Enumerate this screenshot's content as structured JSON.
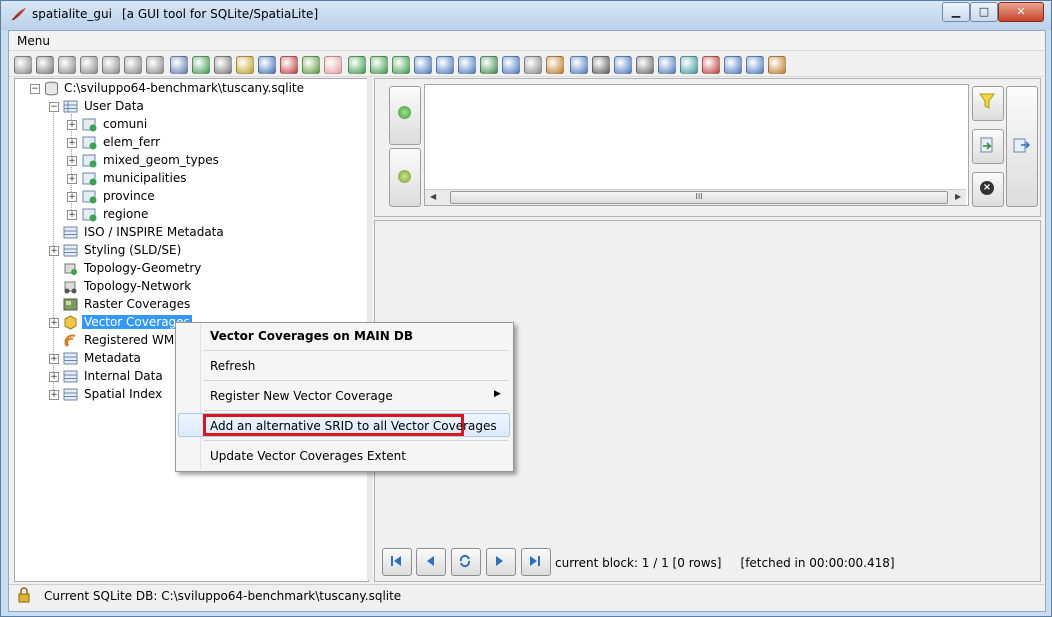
{
  "window": {
    "app_name": "spatialite_gui",
    "subtitle": "[a GUI tool for SQLite/SpatiaLite]",
    "controls": {
      "minimize": "▁",
      "maximize": "□",
      "close": "✕"
    }
  },
  "menubar": {
    "menu_label": "Menu"
  },
  "tree": {
    "root": "C:\\sviluppo64-benchmark\\tuscany.sqlite",
    "user_data": "User Data",
    "tables": [
      "comuni",
      "elem_ferr",
      "mixed_geom_types",
      "municipalities",
      "province",
      "regione"
    ],
    "nodes": {
      "iso": "ISO / INSPIRE Metadata",
      "styling": "Styling (SLD/SE)",
      "topo_geom": "Topology-Geometry",
      "topo_net": "Topology-Network",
      "raster": "Raster Coverages",
      "vector": "Vector Coverages",
      "wms": "Registered WMS l",
      "metadata": "Metadata",
      "internal": "Internal Data",
      "spatial_index": "Spatial Index"
    }
  },
  "context_menu": {
    "header": "Vector Coverages on MAIN DB",
    "refresh": "Refresh",
    "register": "Register New Vector Coverage",
    "add_srid": "Add an alternative SRID to all Vector Coverages",
    "update_extent": "Update Vector Coverages Extent"
  },
  "sql": {
    "scroll_grip": "III"
  },
  "results": {
    "block_info": "current block: 1 / 1 [0 rows]     [fetched in 00:00:00.418]"
  },
  "status": {
    "text": "Current SQLite DB: C:\\sviluppo64-benchmark\\tuscany.sqlite"
  },
  "colors": {
    "selection": "#3399ff",
    "highlight_box": "#e0141e"
  }
}
